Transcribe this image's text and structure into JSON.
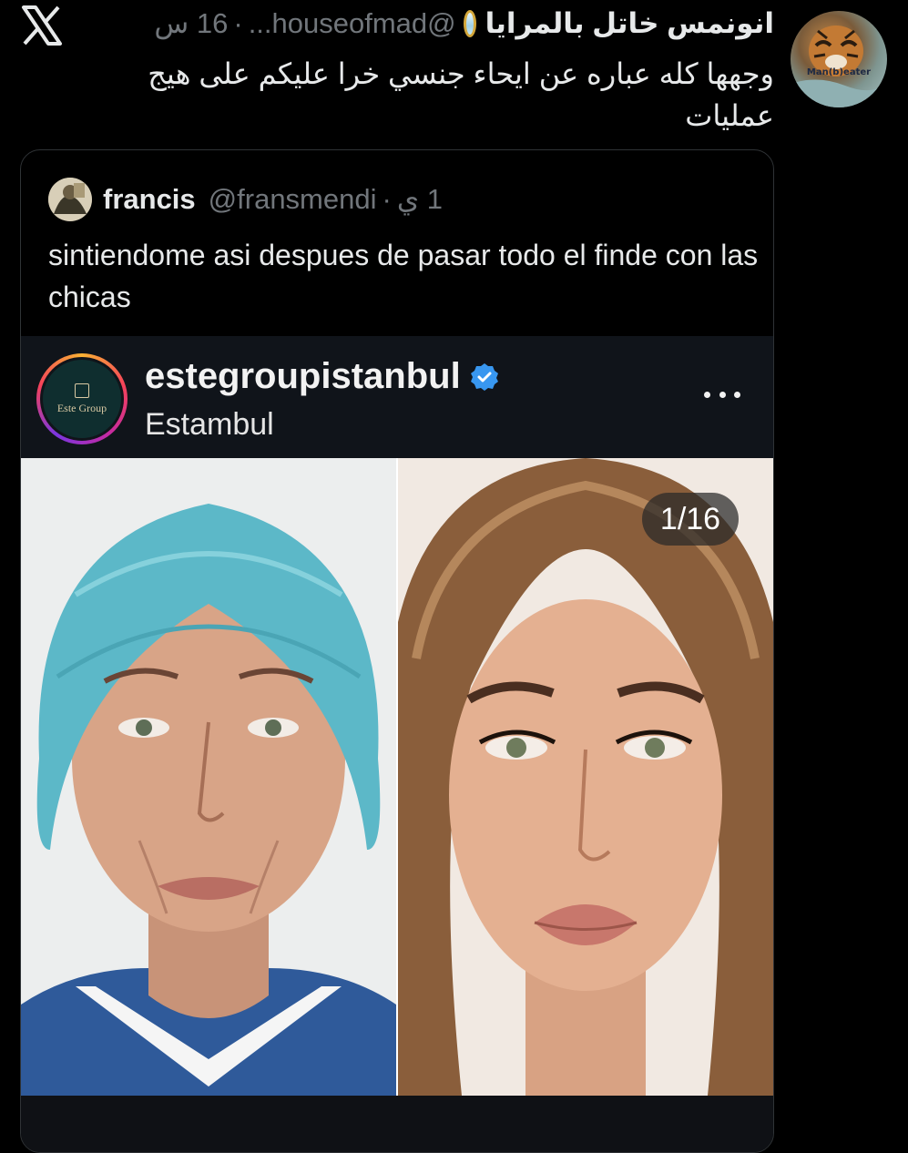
{
  "app": {
    "logo_icon": "x-logo-icon"
  },
  "tweet": {
    "display_name": "انونمس خاتل بالمرايا",
    "name_emoji_icon": "mirror-emoji-icon",
    "handle": "@houseofmad...",
    "separator": "·",
    "time": "16 س",
    "text": "وجهها كله عباره عن ايحاء جنسي خرا عليكم على هيج عمليات",
    "avatar_icon": "tiger-avatar-icon",
    "avatar_caption": "Man(b)eater"
  },
  "quoted_tweet": {
    "display_name": "francis",
    "handle": "@fransmendi",
    "separator": "·",
    "time": "1 ي",
    "text": "sintiendome asi despues de pasar todo el finde con las chicas",
    "avatar_icon": "user-avatar-icon"
  },
  "instagram_post": {
    "username": "estegroupistanbul",
    "verified_icon": "verified-badge-icon",
    "location": "Estambul",
    "avatar_brand": "Este Group",
    "more_icon": "more-horizontal-icon",
    "page_counter": "1/16",
    "images": [
      {
        "name": "before-photo",
        "description_icon": "face-photo-icon"
      },
      {
        "name": "after-photo",
        "description_icon": "face-photo-icon"
      }
    ]
  },
  "colors": {
    "background": "#000000",
    "primary_text": "#e7e9ea",
    "secondary_text": "#71767b",
    "border": "#2f3336",
    "verified_blue": "#3897f0"
  }
}
